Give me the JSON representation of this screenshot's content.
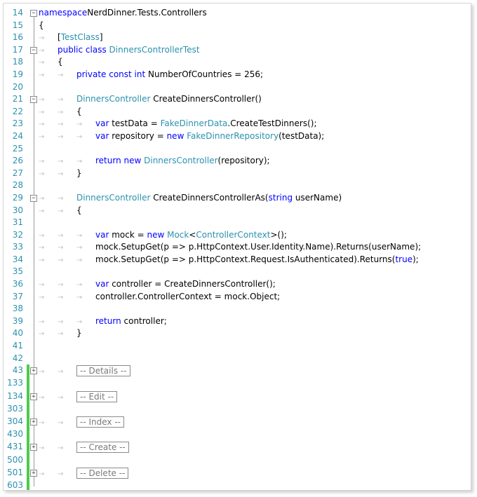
{
  "colors": {
    "line_number": "#2b91af",
    "keyword": "#0000ff",
    "type": "#2b91af",
    "change_margin": "#4ccb4c"
  },
  "lines": [
    {
      "n": "14",
      "fold": "minus",
      "segs": [
        [
          "kw",
          "namespace"
        ],
        [
          "",
          "NerdDinner.Tests.Controllers"
        ]
      ]
    },
    {
      "n": "15",
      "indent": 0,
      "segs": [
        [
          "",
          "{"
        ]
      ]
    },
    {
      "n": "16",
      "indent": 1,
      "segs": [
        [
          "",
          "["
        ],
        [
          "ty",
          "TestClass"
        ],
        [
          "",
          "]"
        ]
      ]
    },
    {
      "n": "17",
      "indent": 1,
      "fold": "minus",
      "segs": [
        [
          "kw",
          "public class "
        ],
        [
          "ty",
          "DinnersControllerTest"
        ]
      ]
    },
    {
      "n": "18",
      "indent": 1,
      "segs": [
        [
          "",
          "{"
        ]
      ]
    },
    {
      "n": "19",
      "indent": 2,
      "segs": [
        [
          "kw",
          "private const int "
        ],
        [
          "",
          "NumberOfCountries = 256;"
        ]
      ]
    },
    {
      "n": "20",
      "segs": []
    },
    {
      "n": "21",
      "indent": 2,
      "fold": "minus",
      "segs": [
        [
          "ty",
          "DinnersController"
        ],
        [
          "",
          " CreateDinnersController()"
        ]
      ]
    },
    {
      "n": "22",
      "indent": 2,
      "segs": [
        [
          "",
          "{"
        ]
      ]
    },
    {
      "n": "23",
      "indent": 3,
      "segs": [
        [
          "kw",
          "var "
        ],
        [
          "",
          "testData = "
        ],
        [
          "ty",
          "FakeDinnerData"
        ],
        [
          "",
          ".CreateTestDinners();"
        ]
      ]
    },
    {
      "n": "24",
      "indent": 3,
      "segs": [
        [
          "kw",
          "var "
        ],
        [
          "",
          "repository = "
        ],
        [
          "kw",
          "new "
        ],
        [
          "ty",
          "FakeDinnerRepository"
        ],
        [
          "",
          "(testData);"
        ]
      ]
    },
    {
      "n": "25",
      "segs": []
    },
    {
      "n": "26",
      "indent": 3,
      "segs": [
        [
          "kw",
          "return new "
        ],
        [
          "ty",
          "DinnersController"
        ],
        [
          "",
          "(repository);"
        ]
      ]
    },
    {
      "n": "27",
      "indent": 2,
      "segs": [
        [
          "",
          "}"
        ]
      ]
    },
    {
      "n": "28",
      "segs": []
    },
    {
      "n": "29",
      "indent": 2,
      "fold": "minus",
      "segs": [
        [
          "ty",
          "DinnersController"
        ],
        [
          "",
          " CreateDinnersControllerAs("
        ],
        [
          "kw",
          "string "
        ],
        [
          "",
          "userName)"
        ]
      ]
    },
    {
      "n": "30",
      "indent": 2,
      "segs": [
        [
          "",
          "{"
        ]
      ]
    },
    {
      "n": "31",
      "segs": []
    },
    {
      "n": "32",
      "indent": 3,
      "segs": [
        [
          "kw",
          "var "
        ],
        [
          "",
          "mock = "
        ],
        [
          "kw",
          "new "
        ],
        [
          "ty",
          "Mock"
        ],
        [
          "",
          "<"
        ],
        [
          "ty",
          "ControllerContext"
        ],
        [
          "",
          ">();"
        ]
      ]
    },
    {
      "n": "33",
      "indent": 3,
      "segs": [
        [
          "",
          "mock.SetupGet(p => p.HttpContext.User.Identity.Name).Returns(userName);"
        ]
      ]
    },
    {
      "n": "34",
      "indent": 3,
      "segs": [
        [
          "",
          "mock.SetupGet(p => p.HttpContext.Request.IsAuthenticated).Returns("
        ],
        [
          "kw",
          "true"
        ],
        [
          "",
          ");"
        ]
      ]
    },
    {
      "n": "35",
      "segs": []
    },
    {
      "n": "36",
      "indent": 3,
      "segs": [
        [
          "kw",
          "var "
        ],
        [
          "",
          "controller = CreateDinnersController();"
        ]
      ]
    },
    {
      "n": "37",
      "indent": 3,
      "segs": [
        [
          "",
          "controller.ControllerContext = mock.Object;"
        ]
      ]
    },
    {
      "n": "38",
      "segs": []
    },
    {
      "n": "39",
      "indent": 3,
      "segs": [
        [
          "kw",
          "return "
        ],
        [
          "",
          "controller;"
        ]
      ]
    },
    {
      "n": "40",
      "indent": 2,
      "segs": [
        [
          "",
          "}"
        ]
      ]
    },
    {
      "n": "41",
      "segs": []
    },
    {
      "n": "42",
      "segs": []
    },
    {
      "n": "43",
      "indent": 2,
      "fold": "plus",
      "changed": true,
      "collapsed": "-- Details --"
    },
    {
      "n": "133",
      "changed": true,
      "segs": []
    },
    {
      "n": "134",
      "indent": 2,
      "fold": "plus",
      "changed": true,
      "collapsed": "-- Edit --"
    },
    {
      "n": "303",
      "changed": true,
      "segs": []
    },
    {
      "n": "304",
      "indent": 2,
      "fold": "plus",
      "changed": true,
      "collapsed": "-- Index --"
    },
    {
      "n": "430",
      "changed": true,
      "segs": []
    },
    {
      "n": "431",
      "indent": 2,
      "fold": "plus",
      "changed": true,
      "collapsed": "-- Create --"
    },
    {
      "n": "500",
      "changed": true,
      "segs": []
    },
    {
      "n": "501",
      "indent": 2,
      "fold": "plus",
      "changed": true,
      "collapsed": "-- Delete --"
    },
    {
      "n": "603",
      "changed": true,
      "segs": []
    }
  ]
}
